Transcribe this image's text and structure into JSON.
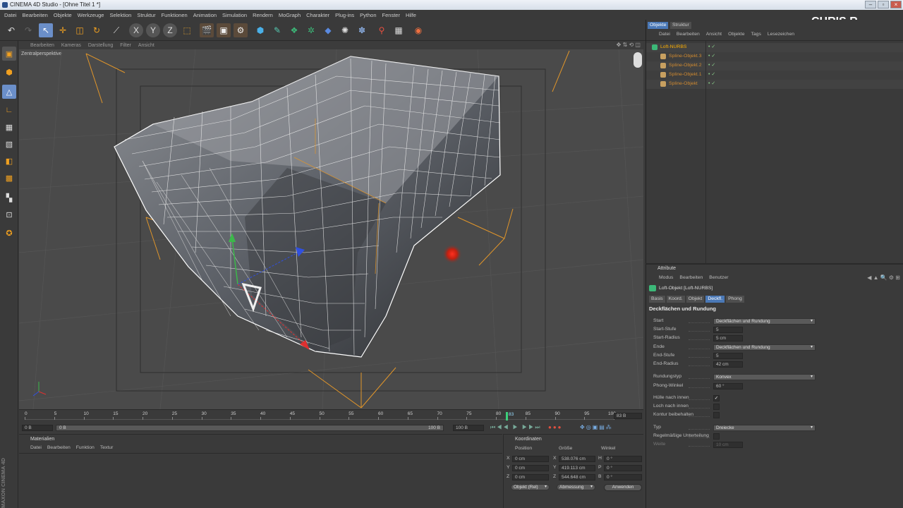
{
  "window": {
    "title": "CINEMA 4D Studio - [Ohne Titel 1 *]"
  },
  "menu": [
    "Datei",
    "Bearbeiten",
    "Objekte",
    "Werkzeuge",
    "Selektion",
    "Struktur",
    "Funktionen",
    "Animation",
    "Simulation",
    "Rendern",
    "MoGraph",
    "Charakter",
    "Plug-ins",
    "Python",
    "Fenster",
    "Hilfe"
  ],
  "watermark": "CHRIS R.",
  "viewport": {
    "menu": [
      "Bearbeiten",
      "Kameras",
      "Darstellung",
      "Filter",
      "Ansicht"
    ],
    "label": "Zentralperspektive"
  },
  "timeline": {
    "ticks": [
      "0",
      "5",
      "10",
      "15",
      "20",
      "25",
      "30",
      "35",
      "40",
      "45",
      "50",
      "55",
      "60",
      "65",
      "70",
      "75",
      "80",
      "85",
      "90",
      "95",
      "100"
    ],
    "current_frame": "83 B",
    "current_marker": "83",
    "start_field": "0 B",
    "min_field": "0 B",
    "end_field": "100 B",
    "max_field": "100 B"
  },
  "materials": {
    "title": "Materialien",
    "menu": [
      "Datei",
      "Bearbeiten",
      "Funktion",
      "Textur"
    ]
  },
  "coords": {
    "title": "Koordinaten",
    "cols": [
      "Position",
      "Größe",
      "Winkel"
    ],
    "rows": [
      {
        "axis": "X",
        "pos": "0 cm",
        "size_axis": "X",
        "size": "538.076 cm",
        "ang_axis": "H",
        "ang": "0 °"
      },
      {
        "axis": "Y",
        "pos": "0 cm",
        "size_axis": "Y",
        "size": "419.113 cm",
        "ang_axis": "P",
        "ang": "0 °"
      },
      {
        "axis": "Z",
        "pos": "0 cm",
        "size_axis": "Z",
        "size": "544.648 cm",
        "ang_axis": "B",
        "ang": "0 °"
      }
    ],
    "mode_select": "Objekt (Rel)",
    "size_select": "Abmessung",
    "apply": "Anwenden"
  },
  "objmgr": {
    "tabs": [
      "Objekte",
      "Struktur"
    ],
    "menu": [
      "Datei",
      "Bearbeiten",
      "Ansicht",
      "Objekte",
      "Tags",
      "Lesezeichen"
    ],
    "items": [
      {
        "name": "Loft-NURBS",
        "color": "#ffb000",
        "indent": 0
      },
      {
        "name": "Spline-Objekt.3",
        "color": "#d08a30",
        "indent": 1
      },
      {
        "name": "Spline-Objekt.2",
        "color": "#d08a30",
        "indent": 1
      },
      {
        "name": "Spline-Objekt.1",
        "color": "#d08a30",
        "indent": 1
      },
      {
        "name": "Spline-Objekt",
        "color": "#d08a30",
        "indent": 1
      }
    ]
  },
  "attr": {
    "title": "Attribute",
    "menu": [
      "Modus",
      "Bearbeiten",
      "Benutzer"
    ],
    "object": "Loft-Objekt [Loft-NURBS]",
    "tabs": [
      "Basis",
      "Koord.",
      "Objekt",
      "Deckfl.",
      "Phong"
    ],
    "active_tab": "Deckfl.",
    "section": "Deckflächen und Rundung",
    "fields": [
      {
        "label": "Start",
        "type": "drop",
        "value": "Deckflächen und Rundung"
      },
      {
        "label": "Start-Stufe",
        "type": "num",
        "value": "5"
      },
      {
        "label": "Start-Radius",
        "type": "num",
        "value": "5 cm"
      },
      {
        "label": "Ende",
        "type": "drop",
        "value": "Deckflächen und Rundung"
      },
      {
        "label": "End-Stufe",
        "type": "num",
        "value": "5"
      },
      {
        "label": "End-Radius",
        "type": "num",
        "value": "42 cm"
      },
      {
        "label": "Rundungstyp",
        "type": "drop",
        "value": "Konvex"
      },
      {
        "label": "Phong-Winkel",
        "type": "num",
        "value": "60 °"
      },
      {
        "label": "Hülle nach innen",
        "type": "check",
        "value": "✓"
      },
      {
        "label": "Loch nach innen",
        "type": "check",
        "value": ""
      },
      {
        "label": "Kontur beibehalten",
        "type": "check",
        "value": ""
      },
      {
        "label": "Typ",
        "type": "drop",
        "value": "Dreiecke"
      },
      {
        "label": "Regelmäßige Unterteilung",
        "type": "check",
        "value": ""
      },
      {
        "label": "Weite",
        "type": "numdim",
        "value": "10 cm"
      }
    ]
  },
  "branding": "MAXON CINEMA 4D"
}
